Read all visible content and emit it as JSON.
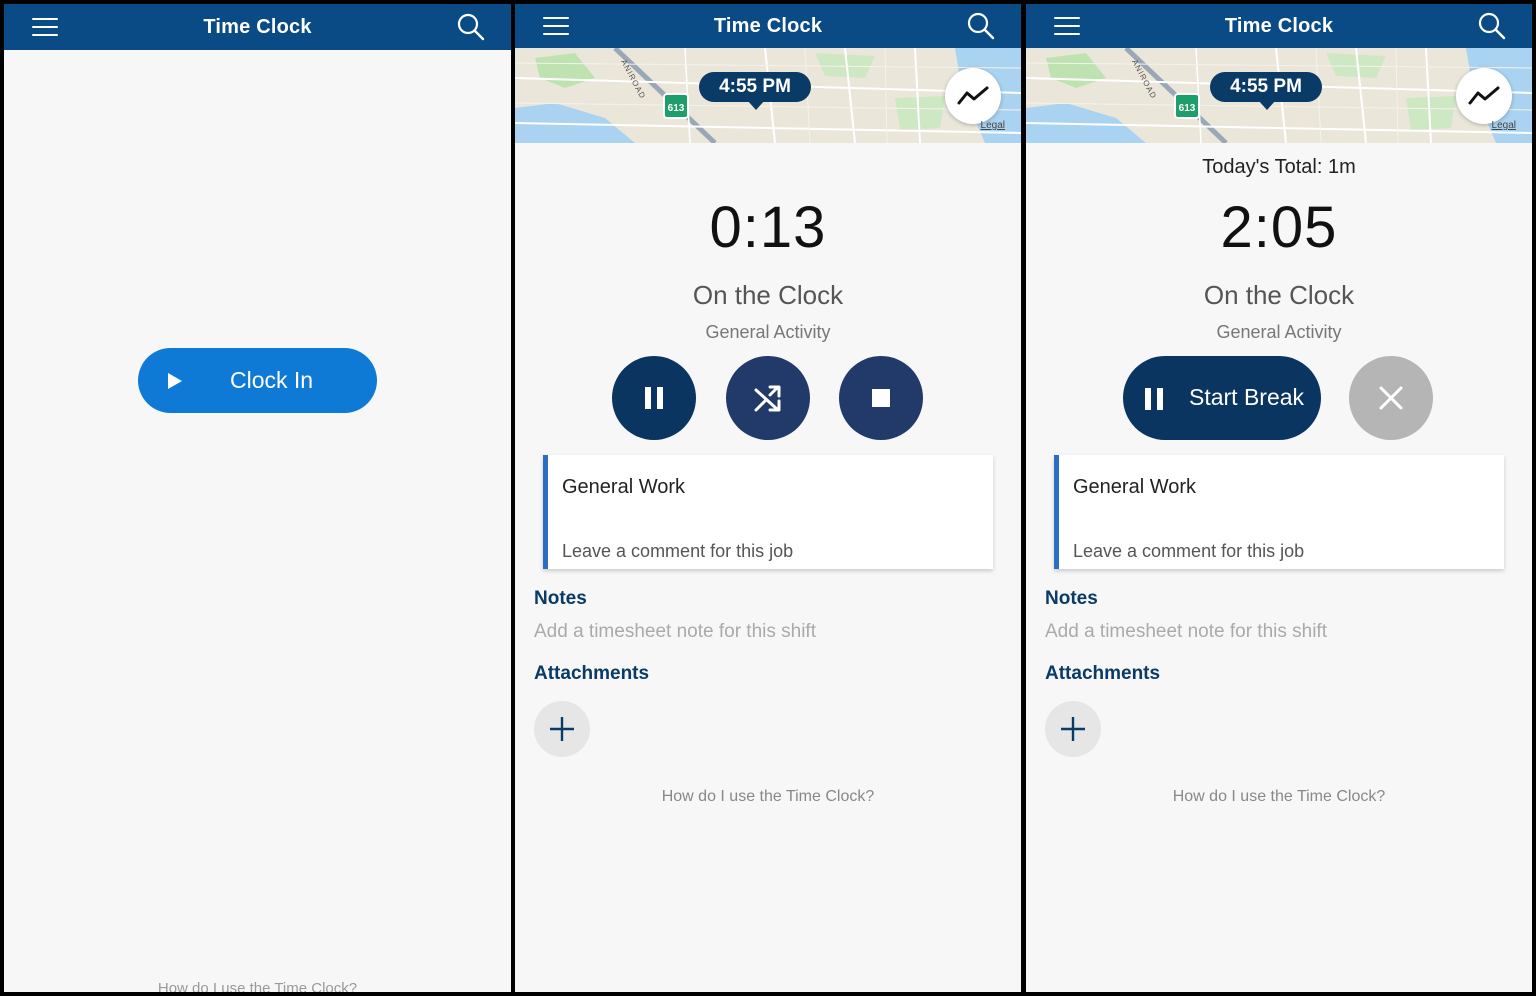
{
  "screens": [
    {
      "title": "Time Clock",
      "clock_in_label": "Clock In",
      "help_link": "How do I use the Time Clock?"
    },
    {
      "title": "Time Clock",
      "map": {
        "time": "4:55 PM",
        "route": "613",
        "road": "ANIROAD",
        "legal": "Legal"
      },
      "elapsed": "0:13",
      "status": "On the Clock",
      "activity": "General Activity",
      "job": {
        "title": "General Work",
        "comment_placeholder": "Leave a comment for this job"
      },
      "notes_label": "Notes",
      "notes_placeholder": "Add a timesheet note for this shift",
      "attachments_label": "Attachments",
      "help_link": "How do I use the Time Clock?"
    },
    {
      "title": "Time Clock",
      "map": {
        "time": "4:55 PM",
        "route": "613",
        "road": "ANIROAD",
        "legal": "Legal"
      },
      "today_total": "Today's Total: 1m",
      "elapsed": "2:05",
      "status": "On the Clock",
      "activity": "General Activity",
      "start_break_label": "Start Break",
      "job": {
        "title": "General Work",
        "comment_placeholder": "Leave a comment for this job"
      },
      "notes_label": "Notes",
      "notes_placeholder": "Add a timesheet note for this shift",
      "attachments_label": "Attachments",
      "help_link": "How do I use the Time Clock?"
    }
  ],
  "icons": [
    "menu-icon",
    "search-icon",
    "trend-icon",
    "play-icon",
    "pause-icon",
    "shuffle-icon",
    "stop-icon",
    "close-icon",
    "plus-icon"
  ],
  "colors": {
    "appbar": "#0a4b85",
    "primary_button": "#0f7ad6",
    "dark_button": "#0a3560",
    "accent_border": "#2a6ec2"
  }
}
